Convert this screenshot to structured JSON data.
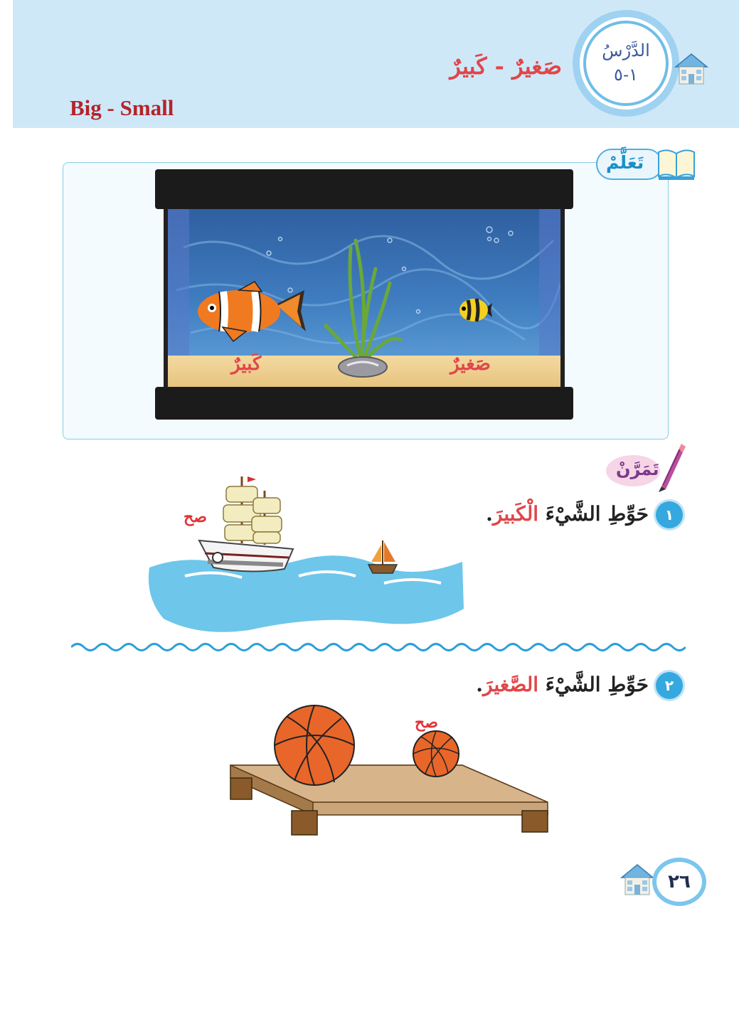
{
  "header": {
    "lesson_word": "الدَّرْسُ",
    "lesson_number": "١-٥",
    "title_ar": "صَغيرٌ - كَبيرٌ",
    "title_en": "Big - Small"
  },
  "learn": {
    "label": "تَعَلَّمْ",
    "big_label": "كَبيرٌ",
    "small_label": "صَغيرٌ"
  },
  "practice": {
    "label": "تَمَرَّنْ",
    "q1": {
      "number": "١",
      "text_prefix": "حَوِّطِ الشَّيْءَ",
      "text_highlight": "الْكَبيرَ",
      "text_suffix": ".",
      "check": "صح"
    },
    "q2": {
      "number": "٢",
      "text_prefix": "حَوِّطِ الشَّيْءَ",
      "text_highlight": "الصَّغيرَ",
      "text_suffix": ".",
      "check": "صح"
    }
  },
  "footer": {
    "page_number": "٢٦"
  },
  "colors": {
    "header_band": "#cfe8f8",
    "accent_red": "#e0464a",
    "accent_blue": "#35a8e0",
    "english_title": "#b5232a"
  },
  "icons": [
    "house-icon",
    "book-icon",
    "pencil-icon"
  ]
}
